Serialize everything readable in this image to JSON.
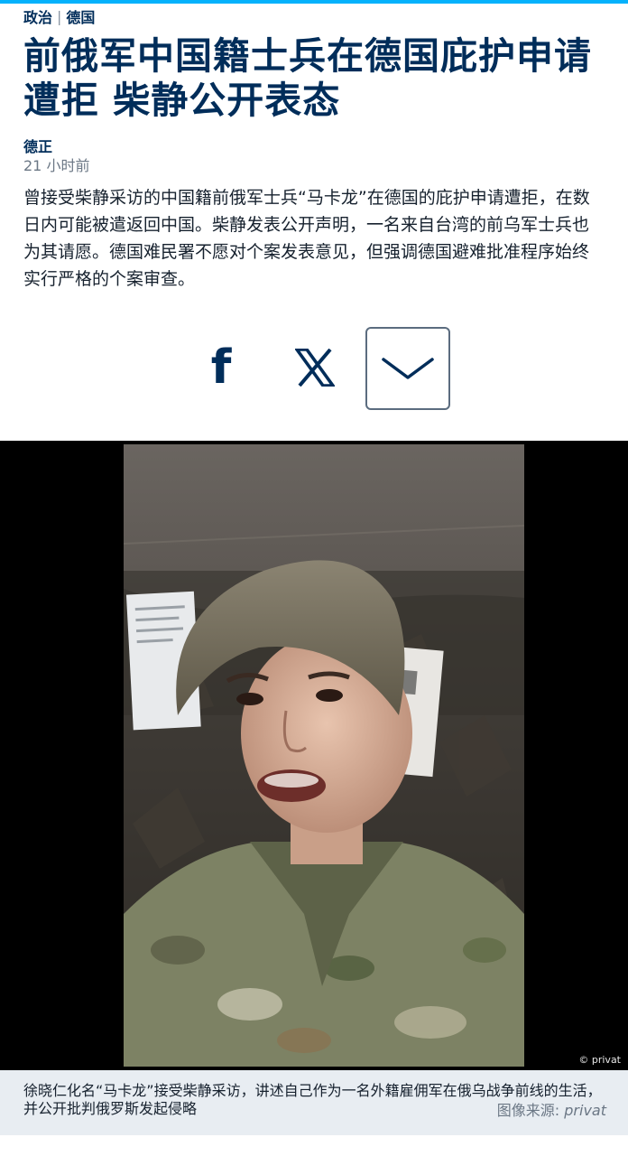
{
  "breadcrumb": {
    "category": "政治",
    "separator": "|",
    "region": "德国"
  },
  "article": {
    "headline": "前俄军中国籍士兵在德国庇护申请遭拒 柴静公开表态",
    "author": "德正",
    "timestamp": "21 小时前",
    "lead": "曾接受柴静采访的中国籍前俄军士兵“马卡龙”在德国的庇护申请遭拒，在数日内可能被遣返回中国。柴静发表公开声明，一名来自台湾的前乌军士兵也为其请愿。德国难民署不愿对个案发表意见，但强调德国避难批准程序始终实行严格的个案审查。"
  },
  "share": {
    "facebook_icon": "facebook-icon",
    "x_icon": "x-icon",
    "more_icon": "chevron-down-icon",
    "facebook_glyph": "f"
  },
  "figure": {
    "credit_badge": "© privat",
    "caption": "徐晓仁化名“马卡龙”接受柴静采访，讲述自己作为一名外籍雇佣军在俄乌战争前线的生活，并公开批判俄罗斯发起侵略",
    "source_label": "图像来源: ",
    "source_name": "privat"
  },
  "colors": {
    "brand_navy": "#002d5a",
    "accent_blue": "#05b2fc",
    "caption_bg": "#e8edf2"
  }
}
